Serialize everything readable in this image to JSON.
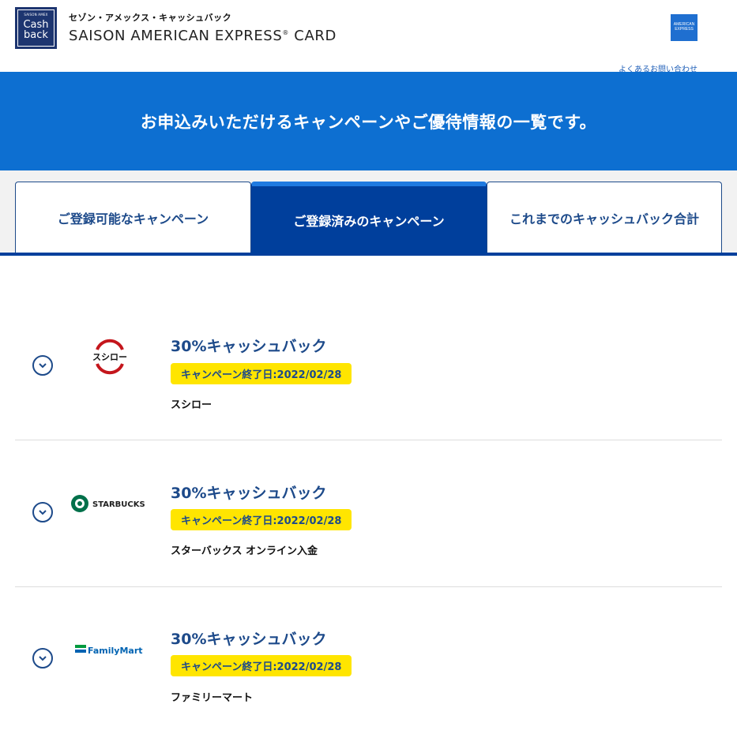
{
  "header": {
    "badge_small": "SAISON AMEX",
    "badge_line1": "Cash",
    "badge_line2": "back",
    "brand_jp": "セゾン・アメックス・キャッシュバック",
    "brand_en": "SAISON AMERICAN EXPRESS",
    "brand_en_mark": "®",
    "brand_en_suffix": " CARD",
    "amex_line1": "AMERICAN",
    "amex_line2": "EXPRESS",
    "faq_link": "よくあるお問い合わせ"
  },
  "banner": {
    "text": "お申込みいただけるキャンペーンやご優待情報の一覧です。"
  },
  "tabs": [
    {
      "label": "ご登録可能なキャンペーン",
      "active": false
    },
    {
      "label": "ご登録済みのキャンペーン",
      "active": true
    },
    {
      "label": "これまでのキャッシュバック合計",
      "active": false
    }
  ],
  "campaigns": [
    {
      "title": "30%キャッシュバック",
      "end_date": "キャンペーン終了日:2022/02/28",
      "merchant": "スシロー",
      "logo_text": "スシロー"
    },
    {
      "title": "30%キャッシュバック",
      "end_date": "キャンペーン終了日:2022/02/28",
      "merchant": "スターバックス オンライン入金",
      "logo_text": "STARBUCKS"
    },
    {
      "title": "30%キャッシュバック",
      "end_date": "キャンペーン終了日:2022/02/28",
      "merchant": "ファミリーマート",
      "logo_text": "FamilyMart"
    }
  ],
  "colors": {
    "banner": "#0d6fd1",
    "tab_active": "#003f9c",
    "badge": "#ffe500",
    "title": "#1d4a8a"
  }
}
